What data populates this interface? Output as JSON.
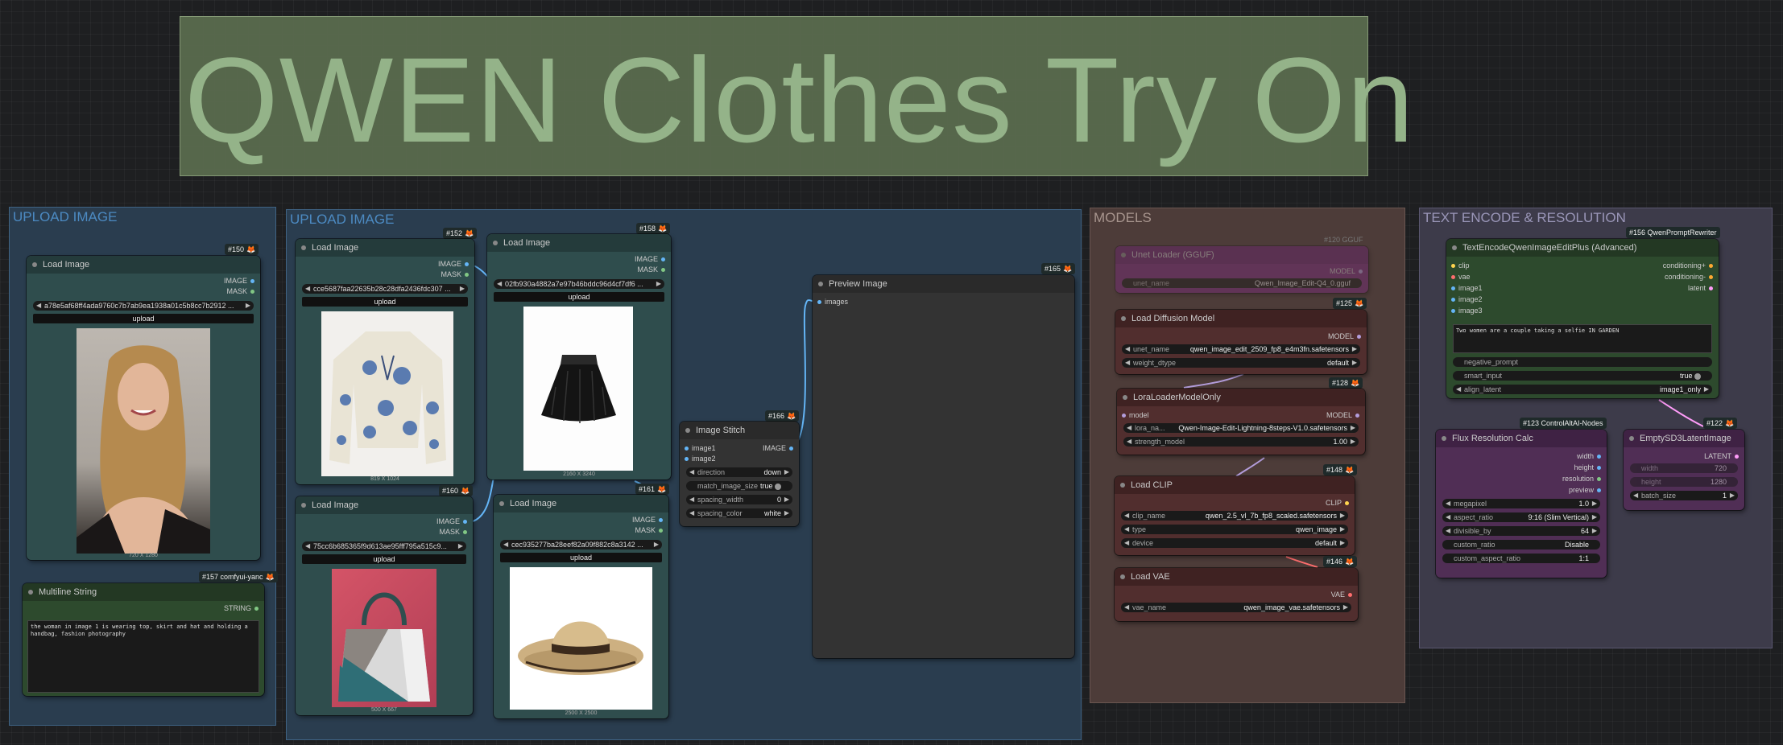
{
  "title": "QWEN Clothes Try On",
  "groups": {
    "upload1": "UPLOAD IMAGE",
    "upload2": "UPLOAD IMAGE",
    "models": "MODELS",
    "text": "TEXT ENCODE & RESOLUTION"
  },
  "nodes": {
    "n150": {
      "id": "#150",
      "title": "Load Image",
      "out1": "IMAGE",
      "out2": "MASK",
      "file": "a78e5af68ff4ada9760c7b7ab9ea1938a01c5b8cc7b2912 ...",
      "upload": "upload",
      "size": "720 X 1280"
    },
    "n157": {
      "id": "#157 comfyui-yanc",
      "title": "Multiline String",
      "out": "STRING",
      "text": "the woman in image 1 is wearing top, skirt and hat and holding a handbag, fashion photography"
    },
    "n152": {
      "id": "#152",
      "title": "Load Image",
      "out1": "IMAGE",
      "out2": "MASK",
      "file": "cce5687faa22635b28c28dfa2436fdc307 ...",
      "upload": "upload",
      "size": "819 X 1024"
    },
    "n158": {
      "id": "#158",
      "title": "Load Image",
      "out1": "IMAGE",
      "out2": "MASK",
      "file": "02fb930a4882a7e97b46bddc96d4cf7df6 ...",
      "upload": "upload",
      "size": "2160 X 3240"
    },
    "n160": {
      "id": "#160",
      "title": "Load Image",
      "out1": "IMAGE",
      "out2": "MASK",
      "file": "75cc6b685365f9d613ae95fff795a515c9...",
      "upload": "upload",
      "size": "500 X 667"
    },
    "n161": {
      "id": "#161",
      "title": "Load Image",
      "out1": "IMAGE",
      "out2": "MASK",
      "file": "cec935277ba28eef82a09f882c8a3142 ...",
      "upload": "upload",
      "size": "2500 X 2500"
    },
    "n166": {
      "id": "#166",
      "title": "Image Stitch",
      "in1": "image1",
      "in2": "image2",
      "out": "IMAGE",
      "w": [
        [
          "direction",
          "down"
        ],
        [
          "match_image_size",
          "true"
        ],
        [
          "spacing_width",
          "0"
        ],
        [
          "spacing_color",
          "white"
        ]
      ]
    },
    "n165": {
      "id": "#165",
      "title": "Preview Image",
      "in": "images"
    },
    "n120": {
      "id": "#120 GGUF",
      "title": "Unet Loader (GGUF)",
      "out": "MODEL",
      "w_label": "unet_name",
      "w_val": "Qwen_Image_Edit-Q4_0.gguf"
    },
    "n125": {
      "id": "#125",
      "title": "Load Diffusion Model",
      "out": "MODEL",
      "w": [
        [
          "unet_name",
          "qwen_image_edit_2509_fp8_e4m3fn.safetensors"
        ],
        [
          "weight_dtype",
          "default"
        ]
      ]
    },
    "n128": {
      "id": "#128",
      "title": "LoraLoaderModelOnly",
      "in": "model",
      "out": "MODEL",
      "w": [
        [
          "lora_na...",
          "Qwen-Image-Edit-Lightning-8steps-V1.0.safetensors"
        ],
        [
          "strength_model",
          "1.00"
        ]
      ]
    },
    "n148": {
      "id": "#148",
      "title": "Load CLIP",
      "out": "CLIP",
      "w": [
        [
          "clip_name",
          "qwen_2.5_vl_7b_fp8_scaled.safetensors"
        ],
        [
          "type",
          "qwen_image"
        ],
        [
          "device",
          "default"
        ]
      ]
    },
    "n146": {
      "id": "#146",
      "title": "Load VAE",
      "out": "VAE",
      "w": [
        [
          "vae_name",
          "qwen_image_vae.safetensors"
        ]
      ]
    },
    "n156": {
      "id": "#156 QwenPromptRewriter",
      "title": "TextEncodeQwenImageEditPlus (Advanced)",
      "ins": [
        "clip",
        "vae",
        "image1",
        "image2",
        "image3"
      ],
      "outs": [
        "conditioning+",
        "conditioning-",
        "latent"
      ],
      "prompt": "Two women are a couple taking a selfie IN GARDEN",
      "w": [
        [
          "negative_prompt",
          ""
        ],
        [
          "smart_input",
          "true"
        ],
        [
          "align_latent",
          "image1_only"
        ]
      ]
    },
    "n123": {
      "id": "#123 ControlAltAI-Nodes",
      "title": "Flux Resolution Calc",
      "outs": [
        "width",
        "height",
        "resolution",
        "preview"
      ],
      "w": [
        [
          "megapixel",
          "1.0"
        ],
        [
          "aspect_ratio",
          "9:16 (Slim Vertical)"
        ],
        [
          "divisible_by",
          "64"
        ],
        [
          "custom_ratio",
          "Disable"
        ],
        [
          "custom_aspect_ratio",
          "1:1"
        ]
      ]
    },
    "n122": {
      "id": "#122",
      "title": "EmptySD3LatentImage",
      "out": "LATENT",
      "w": [
        [
          "width",
          "720"
        ],
        [
          "height",
          "1280"
        ],
        [
          "batch_size",
          "1"
        ]
      ]
    }
  },
  "colors": {
    "image_pin": "#64b5f6",
    "mask_pin": "#81c784",
    "model_pin": "#b39ddb",
    "clip_pin": "#ffd54f",
    "vae_pin": "#ff6e6e",
    "latent_pin": "#ff9cf9",
    "cond_pin": "#ffa931"
  }
}
